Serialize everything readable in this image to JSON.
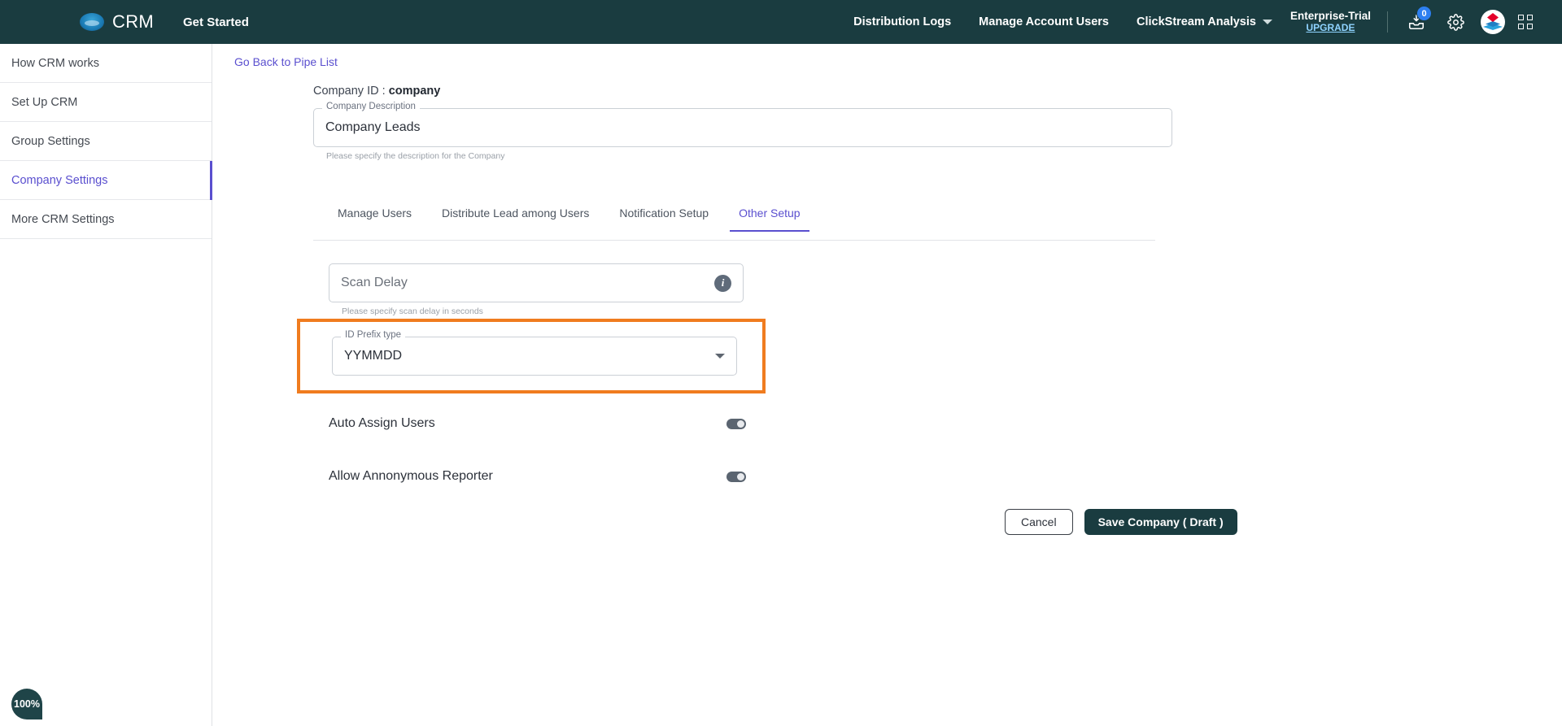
{
  "topnav": {
    "brand": "CRM",
    "get_started": "Get Started",
    "links": [
      {
        "label": "Distribution Logs"
      },
      {
        "label": "Manage Account Users"
      },
      {
        "label": "ClickStream Analysis"
      }
    ],
    "plan_name": "Enterprise-Trial",
    "upgrade_label": "UPGRADE",
    "inbox_badge_count": "0",
    "accent_color": "#1a3c40",
    "badge_color": "#2d7ff0"
  },
  "sidebar": {
    "items": [
      {
        "label": "How CRM works",
        "active": false
      },
      {
        "label": "Set Up CRM",
        "active": false
      },
      {
        "label": "Group Settings",
        "active": false
      },
      {
        "label": "Company Settings",
        "active": true
      },
      {
        "label": "More CRM Settings",
        "active": false
      }
    ],
    "active_color": "#5a4fcf"
  },
  "main": {
    "back_link": "Go Back to Pipe List",
    "company_id_label": "Company ID :",
    "company_id_value": "company",
    "description": {
      "label": "Company Description",
      "value": "Company Leads",
      "helper": "Please specify the description for the Company"
    },
    "tabs": [
      {
        "label": "Manage Users",
        "active": false
      },
      {
        "label": "Distribute Lead among Users",
        "active": false
      },
      {
        "label": "Notification Setup",
        "active": false
      },
      {
        "label": "Other Setup",
        "active": true
      }
    ],
    "other_setup": {
      "scan_delay": {
        "placeholder": "Scan Delay",
        "value": "",
        "helper": "Please specify scan delay in seconds",
        "info_glyph": "i"
      },
      "id_prefix": {
        "label": "ID Prefix type",
        "value": "YYMMDD",
        "highlight_color": "#f07c1f"
      },
      "toggles": [
        {
          "label": "Auto Assign Users",
          "on": false
        },
        {
          "label": "Allow Annonymous Reporter",
          "on": false
        }
      ]
    },
    "footer": {
      "cancel_label": "Cancel",
      "save_label": "Save Company ( Draft )"
    }
  },
  "zoom_badge": {
    "value": "100%"
  }
}
